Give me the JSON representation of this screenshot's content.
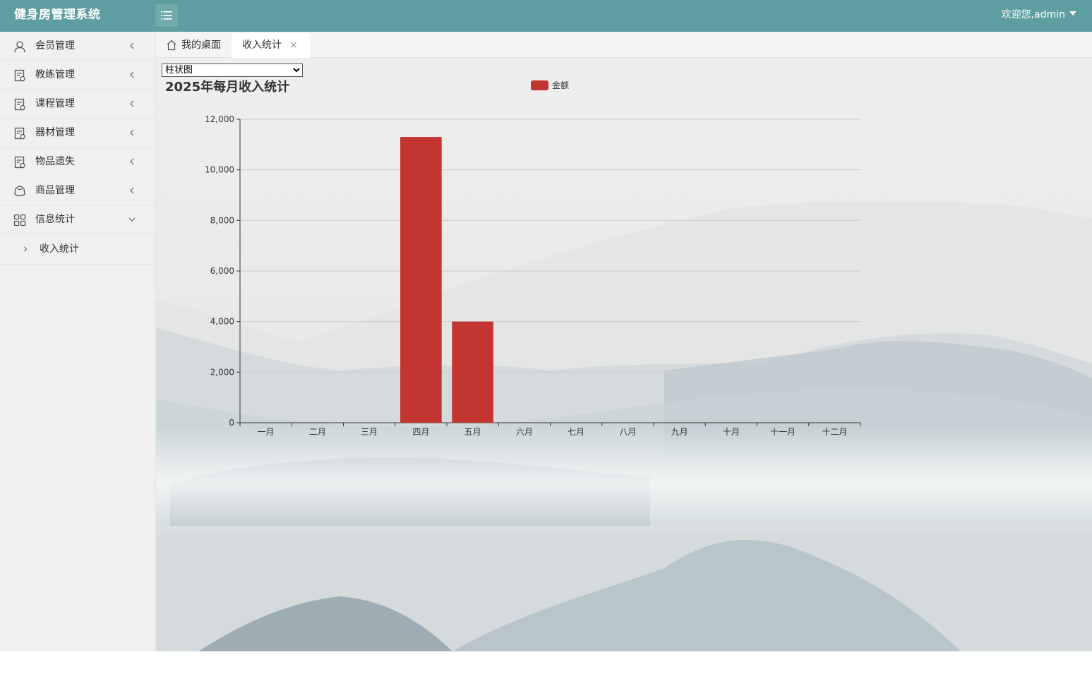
{
  "app": {
    "title": "健身房管理系统"
  },
  "header": {
    "welcome": "欢迎您,admin"
  },
  "sidebar": {
    "items": [
      {
        "label": "会员管理",
        "icon": "user-icon",
        "expanded": false
      },
      {
        "label": "教练管理",
        "icon": "document-icon",
        "expanded": false
      },
      {
        "label": "课程管理",
        "icon": "document-icon",
        "expanded": false
      },
      {
        "label": "器材管理",
        "icon": "document-icon",
        "expanded": false
      },
      {
        "label": "物品遗失",
        "icon": "document-icon",
        "expanded": false
      },
      {
        "label": "商品管理",
        "icon": "box-icon",
        "expanded": false
      },
      {
        "label": "信息统计",
        "icon": "grid-icon",
        "expanded": true
      }
    ],
    "subitems": [
      {
        "label": "收入统计"
      }
    ]
  },
  "tabs": [
    {
      "label": "我的桌面",
      "icon": "home-icon",
      "active": false
    },
    {
      "label": "收入统计",
      "active": true,
      "close": "×"
    }
  ],
  "chart_select": {
    "value": "柱状图",
    "options": [
      "柱状图"
    ]
  },
  "colors": {
    "header": "#5f9ea0",
    "bar": "#c23531"
  },
  "chart_data": {
    "type": "bar",
    "title": "2025年每月收入统计",
    "legend_position": "top-center",
    "categories": [
      "一月",
      "二月",
      "三月",
      "四月",
      "五月",
      "六月",
      "七月",
      "八月",
      "九月",
      "十月",
      "十一月",
      "十二月"
    ],
    "series": [
      {
        "name": "金额",
        "values": [
          0,
          0,
          0,
          11300,
          4000,
          0,
          0,
          0,
          0,
          0,
          0,
          0
        ]
      }
    ],
    "ylim": [
      0,
      12000
    ],
    "yticks": [
      "0",
      "2,000",
      "4,000",
      "6,000",
      "8,000",
      "10,000",
      "12,000"
    ],
    "grid": true,
    "xlabel": "",
    "ylabel": ""
  }
}
